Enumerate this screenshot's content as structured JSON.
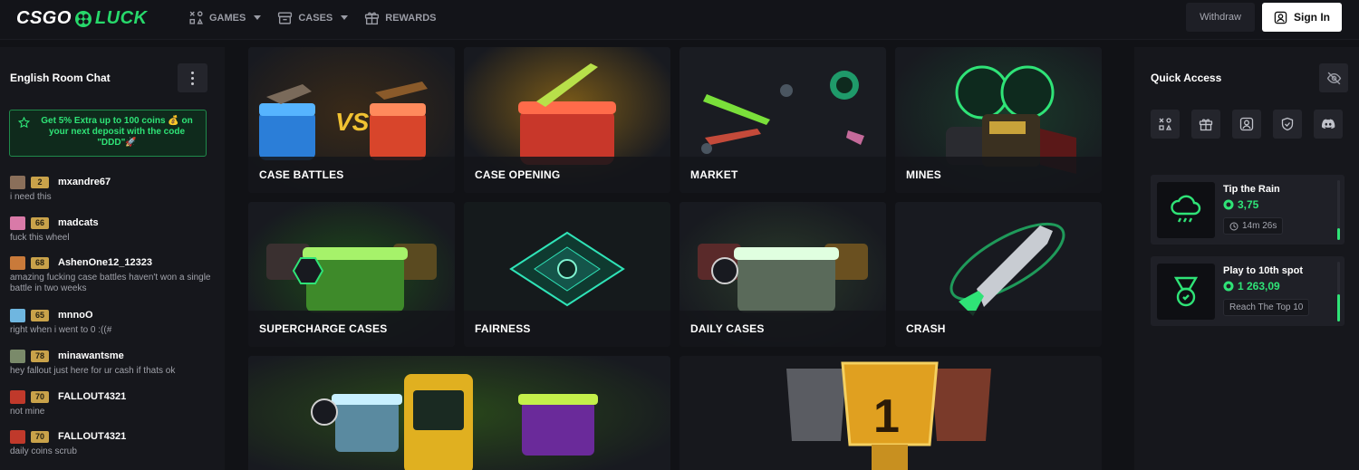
{
  "header": {
    "logo_left": "CSGO",
    "logo_right": "LUCK",
    "nav": [
      {
        "label": "GAMES",
        "dropdown": true,
        "icon": "games-icon"
      },
      {
        "label": "CASES",
        "dropdown": true,
        "icon": "cases-icon"
      },
      {
        "label": "REWARDS",
        "dropdown": false,
        "icon": "gift-icon"
      }
    ],
    "withdraw_label": "Withdraw",
    "signin_label": "Sign In"
  },
  "chat": {
    "title": "English Room Chat",
    "promo": "Get 5% Extra up to 100 coins 💰 on your next deposit with the code \"DDD\"🚀",
    "messages": [
      {
        "level": "2",
        "user": "mxandre67",
        "text": "i need this",
        "avatar_color": "#8a6f5a"
      },
      {
        "level": "66",
        "user": "madcats",
        "text": "fuck this wheel",
        "avatar_color": "#d97aa8"
      },
      {
        "level": "68",
        "user": "AshenOne12_12323",
        "text": "amazing fucking case battles haven't won a single battle in two weeks",
        "avatar_color": "#c97a3a"
      },
      {
        "level": "65",
        "user": "mnnoO",
        "text": "right when i went to 0 :((#",
        "avatar_color": "#6fb6e0"
      },
      {
        "level": "78",
        "user": "minawantsme",
        "text": "hey fallout just here for ur cash if thats ok",
        "avatar_color": "#7a8a6a"
      },
      {
        "level": "70",
        "user": "FALLOUT4321",
        "text": "not mine",
        "avatar_color": "#c0392b"
      },
      {
        "level": "70",
        "user": "FALLOUT4321",
        "text": "daily coins scrub",
        "avatar_color": "#c0392b"
      }
    ]
  },
  "tiles": [
    {
      "label": "CASE BATTLES"
    },
    {
      "label": "CASE OPENING"
    },
    {
      "label": "MARKET"
    },
    {
      "label": "MINES"
    },
    {
      "label": "SUPERCHARGE CASES"
    },
    {
      "label": "FAIRNESS"
    },
    {
      "label": "DAILY CASES"
    },
    {
      "label": "CRASH"
    },
    {
      "label": ""
    },
    {
      "label": ""
    }
  ],
  "quick_access": {
    "title": "Quick Access",
    "buttons": [
      "games-icon",
      "gift-icon",
      "profile-icon",
      "shield-icon",
      "discord-icon"
    ],
    "cards": [
      {
        "title": "Tip the Rain",
        "amount": "3,75",
        "chip": "14m 26s",
        "progress": 0.2
      },
      {
        "title": "Play to 10th spot",
        "amount": "1 263,09",
        "chip": "Reach The Top 10",
        "progress": 0.45
      }
    ]
  },
  "colors": {
    "accent": "#27d96b",
    "background": "#111216",
    "panel": "#16171c"
  }
}
